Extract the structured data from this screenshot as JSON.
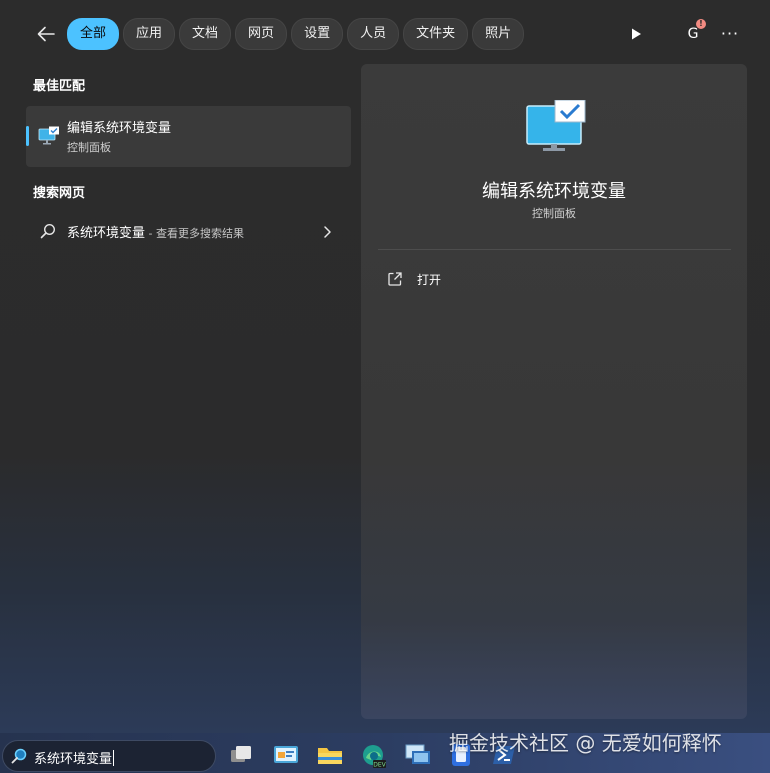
{
  "filters": {
    "back_icon": "arrow-left-icon",
    "chips": [
      "全部",
      "应用",
      "文档",
      "网页",
      "设置",
      "人员",
      "文件夹",
      "照片"
    ],
    "active": "全部",
    "avatar_letter": "G",
    "avatar_badge": "!",
    "more_label": "···"
  },
  "left": {
    "best_match_heading": "最佳匹配",
    "best_match": {
      "title": "编辑系统环境变量",
      "subtitle": "控制面板",
      "icon": "monitor-checkmark-icon"
    },
    "web_heading": "搜索网页",
    "web_item": {
      "query": "系统环境变量",
      "hint": " - 查看更多搜索结果",
      "icon": "search-icon"
    }
  },
  "detail": {
    "title": "编辑系统环境变量",
    "subtitle": "控制面板",
    "open_label": "打开",
    "open_icon": "open-external-icon"
  },
  "taskbar": {
    "search_value": "系统环境变量",
    "apps": [
      "task-view-icon",
      "control-panel-icon",
      "file-explorer-icon",
      "edge-dev-icon",
      "remote-desktop-icon",
      "phone-link-icon",
      "powershell-icon"
    ]
  },
  "watermark": "掘金技术社区 @ 无爱如何释怀",
  "colors": {
    "accent": "#4cc2ff",
    "panel": "#2c2c2c",
    "detail_pane": "#3b3b3b"
  }
}
